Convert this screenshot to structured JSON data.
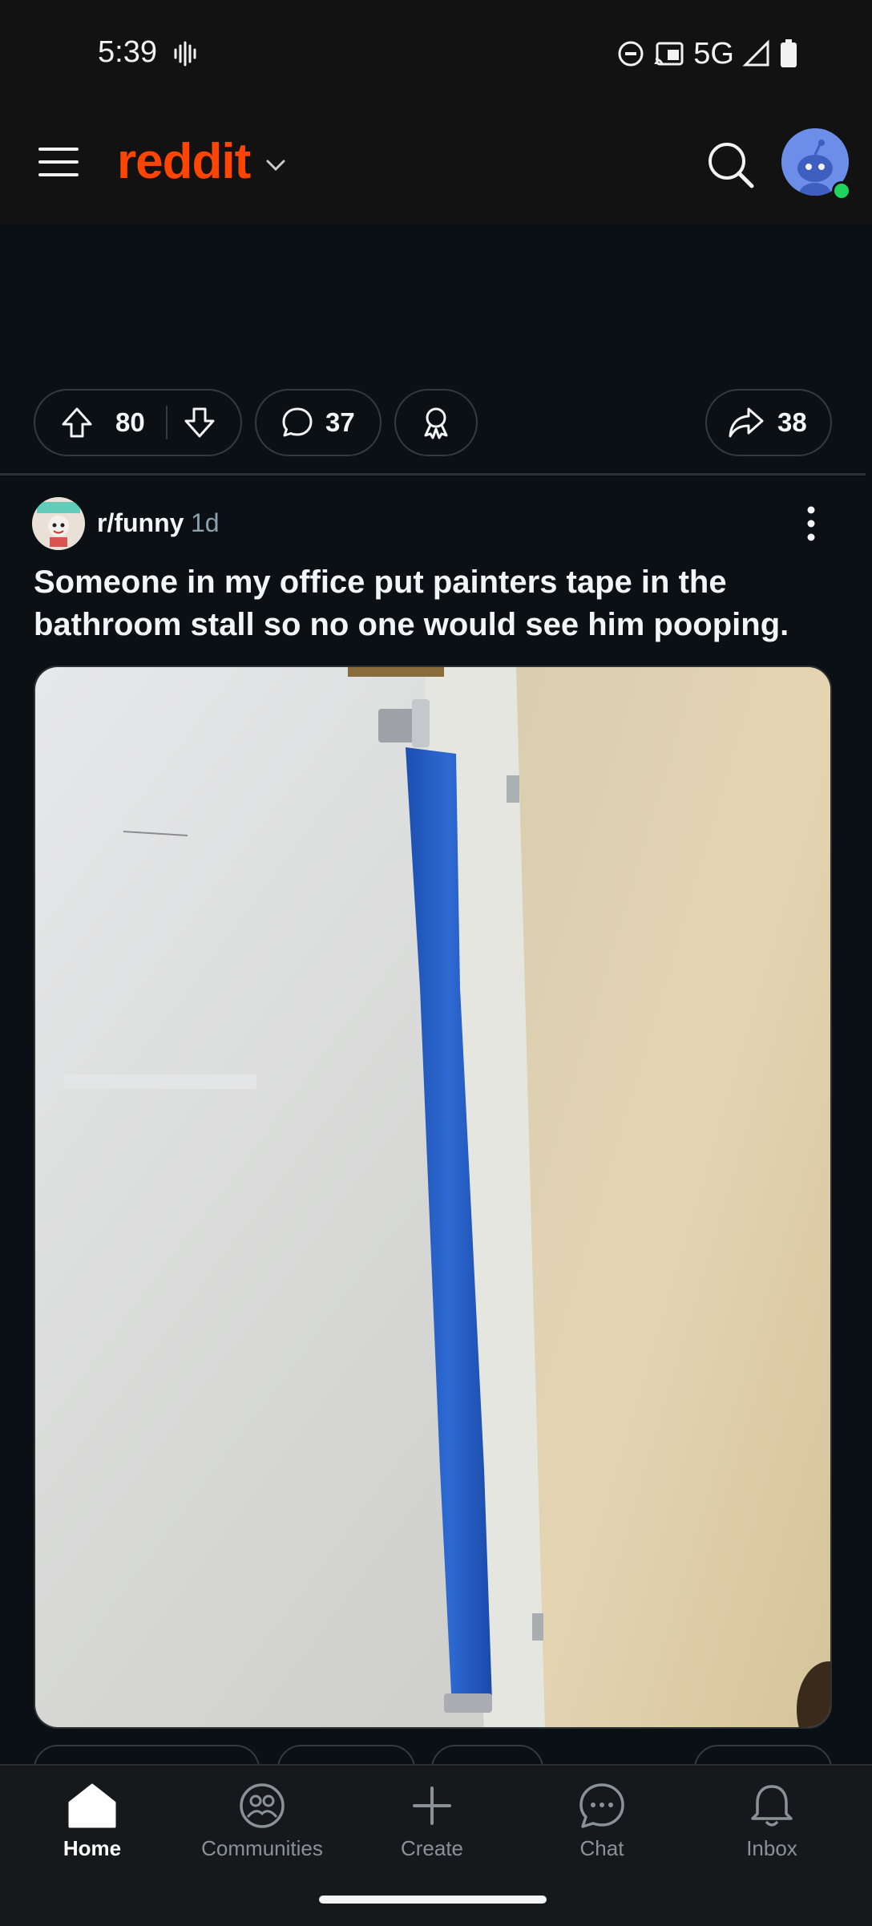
{
  "status_bar": {
    "time": "5:39",
    "network": "5G"
  },
  "app": {
    "logo": "reddit"
  },
  "icons": {
    "menu": "menu-icon",
    "logo_chevron": "chevron-down-icon",
    "search": "search-icon",
    "upvote": "upvote-arrow-icon",
    "downvote": "downvote-arrow-icon",
    "comment": "comment-bubble-icon",
    "award": "award-ribbon-icon",
    "share": "share-arrow-icon",
    "more": "more-vertical-icon"
  },
  "prev_post_actions": {
    "votes": "80",
    "comments": "37",
    "shares": "38"
  },
  "post": {
    "subreddit": "r/funny",
    "age": "1d",
    "title": "Someone in my office put painters tape in the bathroom stall so no one would see him pooping."
  },
  "bottom_nav": {
    "items": [
      {
        "label": "Home",
        "icon": "home-icon",
        "active": true
      },
      {
        "label": "Communities",
        "icon": "communities-icon",
        "active": false
      },
      {
        "label": "Create",
        "icon": "plus-icon",
        "active": false
      },
      {
        "label": "Chat",
        "icon": "chat-icon",
        "active": false
      },
      {
        "label": "Inbox",
        "icon": "bell-icon",
        "active": false
      }
    ]
  },
  "colors": {
    "brand": "#ff4500",
    "background": "#0b1014",
    "online": "#1fd35d"
  }
}
